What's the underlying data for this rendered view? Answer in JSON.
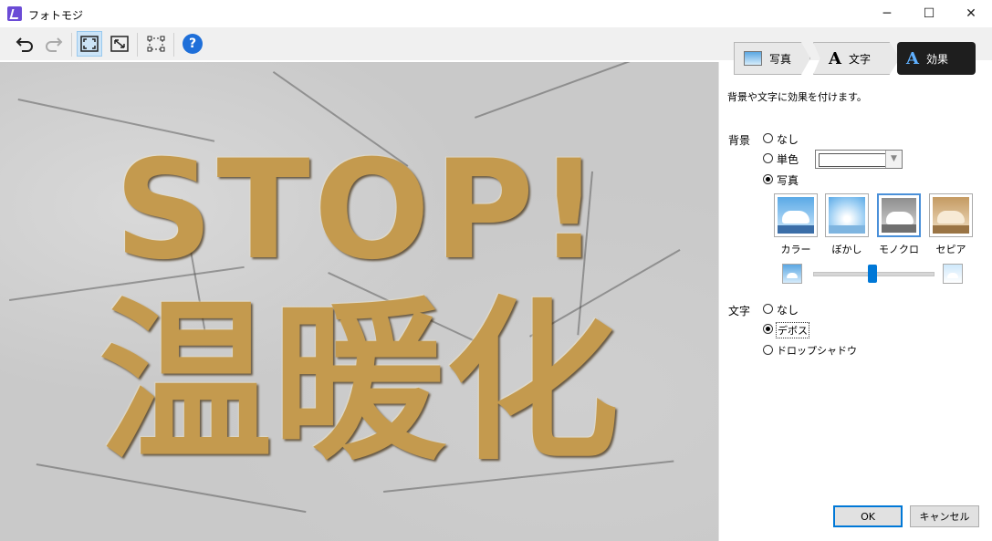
{
  "window": {
    "title": "フォトモジ",
    "minimize": "─",
    "maximize": "☐",
    "close": "✕"
  },
  "toolbar": {
    "help": "?"
  },
  "canvas": {
    "line1": "STOP!",
    "line2": "温暖化"
  },
  "steps": [
    {
      "label": "写真"
    },
    {
      "label": "文字"
    },
    {
      "label": "効果"
    }
  ],
  "panel": {
    "description": "背景や文字に効果を付けます。",
    "background_label": "背景",
    "bg_options": [
      "なし",
      "単色",
      "写真"
    ],
    "bg_selected": "写真",
    "photo_styles": [
      {
        "label": "カラー",
        "sky": "#5aa9e6",
        "ground": "#3b6ea8"
      },
      {
        "label": "ぼかし",
        "sky": "#9fd0f4",
        "ground": "#7fb5e0"
      },
      {
        "label": "モノクロ",
        "sky": "#a8a8a8",
        "ground": "#707070"
      },
      {
        "label": "セピア",
        "sky": "#d9b88a",
        "ground": "#9a7444"
      }
    ],
    "photo_style_selected": "モノクロ",
    "text_label": "文字",
    "text_options": [
      "なし",
      "デボス",
      "ドロップシャドウ"
    ],
    "text_selected": "デボス"
  },
  "buttons": {
    "ok": "OK",
    "cancel": "キャンセル"
  }
}
